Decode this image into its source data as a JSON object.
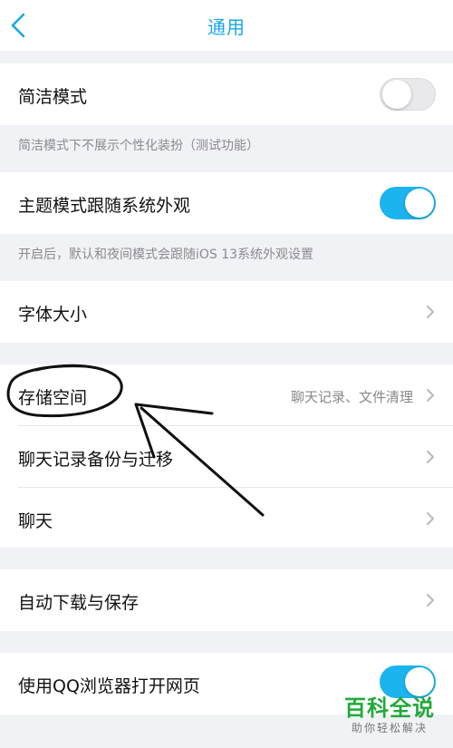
{
  "header": {
    "title": "通用",
    "back_icon": "chevron-left-icon"
  },
  "settings": {
    "simple_mode": {
      "label": "简洁模式",
      "toggle_on": false,
      "note": "简洁模式下不展示个性化装扮（测试功能）"
    },
    "theme_follow": {
      "label": "主题模式跟随系统外观",
      "toggle_on": true,
      "note": "开启后，默认和夜间模式会跟随iOS 13系统外观设置"
    },
    "font_size": {
      "label": "字体大小"
    },
    "storage": {
      "label": "存储空间",
      "value": "聊天记录、文件清理"
    },
    "backup": {
      "label": "聊天记录备份与迁移"
    },
    "chat": {
      "label": "聊天"
    },
    "auto_download": {
      "label": "自动下载与保存"
    },
    "qq_browser": {
      "label": "使用QQ浏览器打开网页",
      "toggle_on": true
    }
  },
  "watermark": {
    "line1": "百科全说",
    "line2": "助你轻松解决"
  },
  "colors": {
    "accent": "#1cb4ef",
    "title": "#16a7e7",
    "watermark": "#22a83a"
  }
}
